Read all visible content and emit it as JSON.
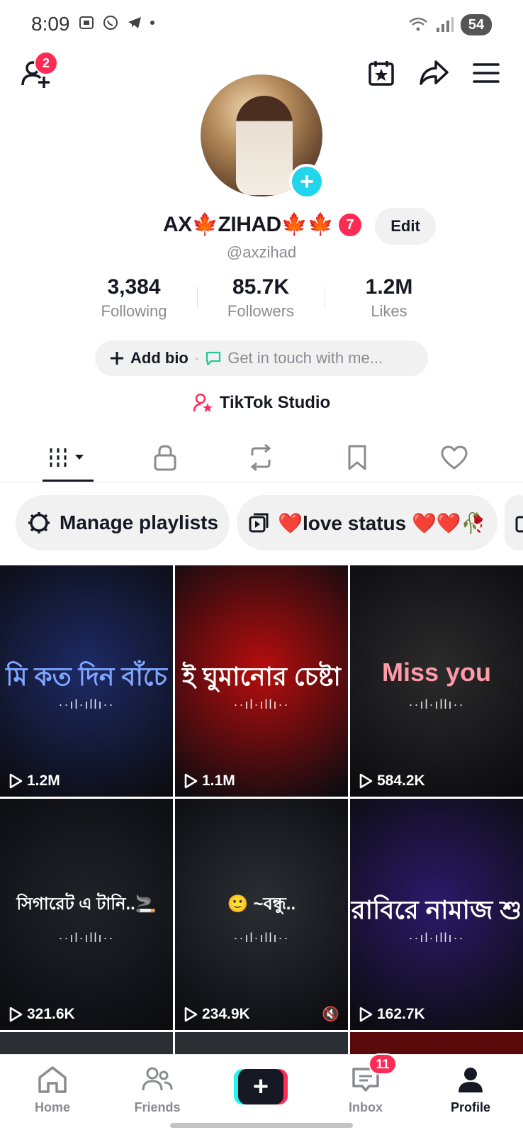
{
  "status_bar": {
    "time": "8:09",
    "battery": "54"
  },
  "header": {
    "friend_requests_badge": "2"
  },
  "profile": {
    "display_name": "AX🍁ZIHAD🍁🍁",
    "name_badge": "7",
    "edit_label": "Edit",
    "username": "@axzihad"
  },
  "stats": [
    {
      "value": "3,384",
      "label": "Following"
    },
    {
      "value": "85.7K",
      "label": "Followers"
    },
    {
      "value": "1.2M",
      "label": "Likes"
    }
  ],
  "bio": {
    "add_bio": "Add bio",
    "contact": "Get in touch with me..."
  },
  "studio": {
    "label": "TikTok Studio"
  },
  "playlists": [
    {
      "label": "Manage playlists",
      "icon": "gear-icon"
    },
    {
      "label": "❤️love status ❤️❤️🥀",
      "icon": "playlist-icon"
    }
  ],
  "videos": [
    {
      "views": "1.2M",
      "overlay": "মি কত দিন বাঁচে",
      "bg": "#1d2a66"
    },
    {
      "views": "1.1M",
      "overlay": "ই ঘুমানোর চেষ্টা",
      "bg": "#b80d0d"
    },
    {
      "views": "584.2K",
      "overlay": "Miss you",
      "bg": "#2b2b2b"
    },
    {
      "views": "321.6K",
      "overlay": "সিগারেট এ টানি..🚬",
      "bg": "#1e2328"
    },
    {
      "views": "234.9K",
      "overlay": "🙂 ~বন্ধু..",
      "bg": "#2a2e33"
    },
    {
      "views": "162.7K",
      "overlay": "রাবিরে নামাজ শু",
      "bg": "#2a1a6a"
    }
  ],
  "bottom_nav": {
    "home": "Home",
    "friends": "Friends",
    "inbox": "Inbox",
    "inbox_badge": "11",
    "profile": "Profile"
  }
}
